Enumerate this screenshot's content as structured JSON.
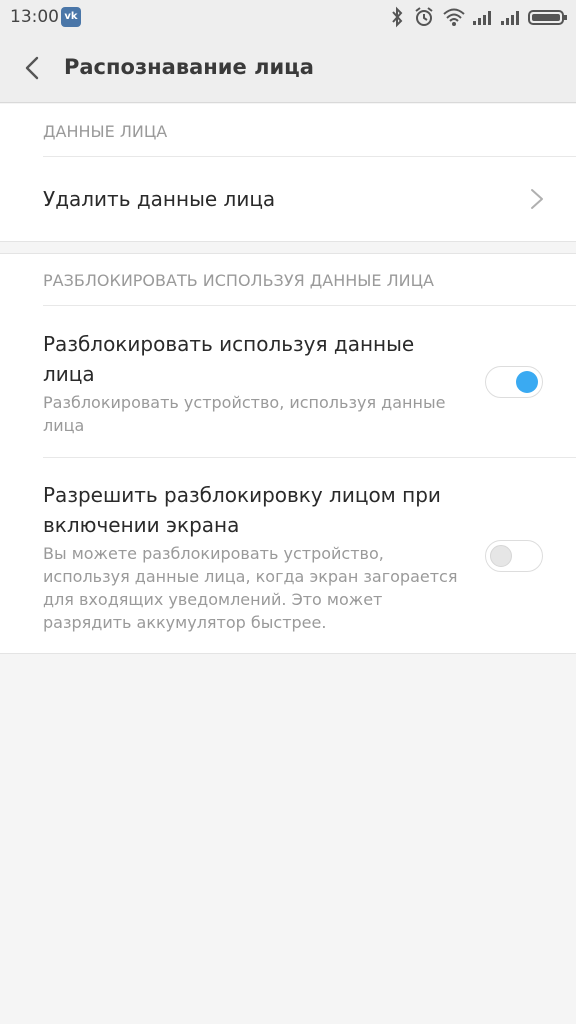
{
  "status_bar": {
    "time": "13:00",
    "notification_icon": "vk-icon",
    "icons": [
      "bluetooth-icon",
      "alarm-icon",
      "wifi-icon",
      "signal-icon",
      "signal-icon",
      "battery-icon"
    ]
  },
  "toolbar": {
    "title": "Распознавание лица",
    "back_icon": "chevron-left-icon"
  },
  "sections": [
    {
      "header": "ДАННЫЕ ЛИЦА",
      "items": [
        {
          "title": "Удалить данные лица",
          "trailing": "chevron-right-icon"
        }
      ]
    },
    {
      "header": "РАЗБЛОКИРОВАТЬ ИСПОЛЬЗУЯ ДАННЫЕ ЛИЦА",
      "items": [
        {
          "title_lines": [
            "Разблокировать используя данные",
            "лица"
          ],
          "subtitle_lines": [
            "Разблокировать устройство, используя данные",
            "лица"
          ],
          "toggle": true
        },
        {
          "title_lines": [
            "Разрешить разблокировку лицом при",
            "включении экрана"
          ],
          "subtitle_lines": [
            "Вы можете разблокировать устройство,",
            "используя данные лица, когда экран загорается",
            "для входящих уведомлений. Это может",
            "разрядить аккумулятор быстрее."
          ],
          "toggle": false
        }
      ]
    }
  ],
  "colors": {
    "accent": "#3aaaf2",
    "background": "#f5f5f5",
    "card": "#ffffff",
    "secondary_text": "#9a9a9a"
  }
}
